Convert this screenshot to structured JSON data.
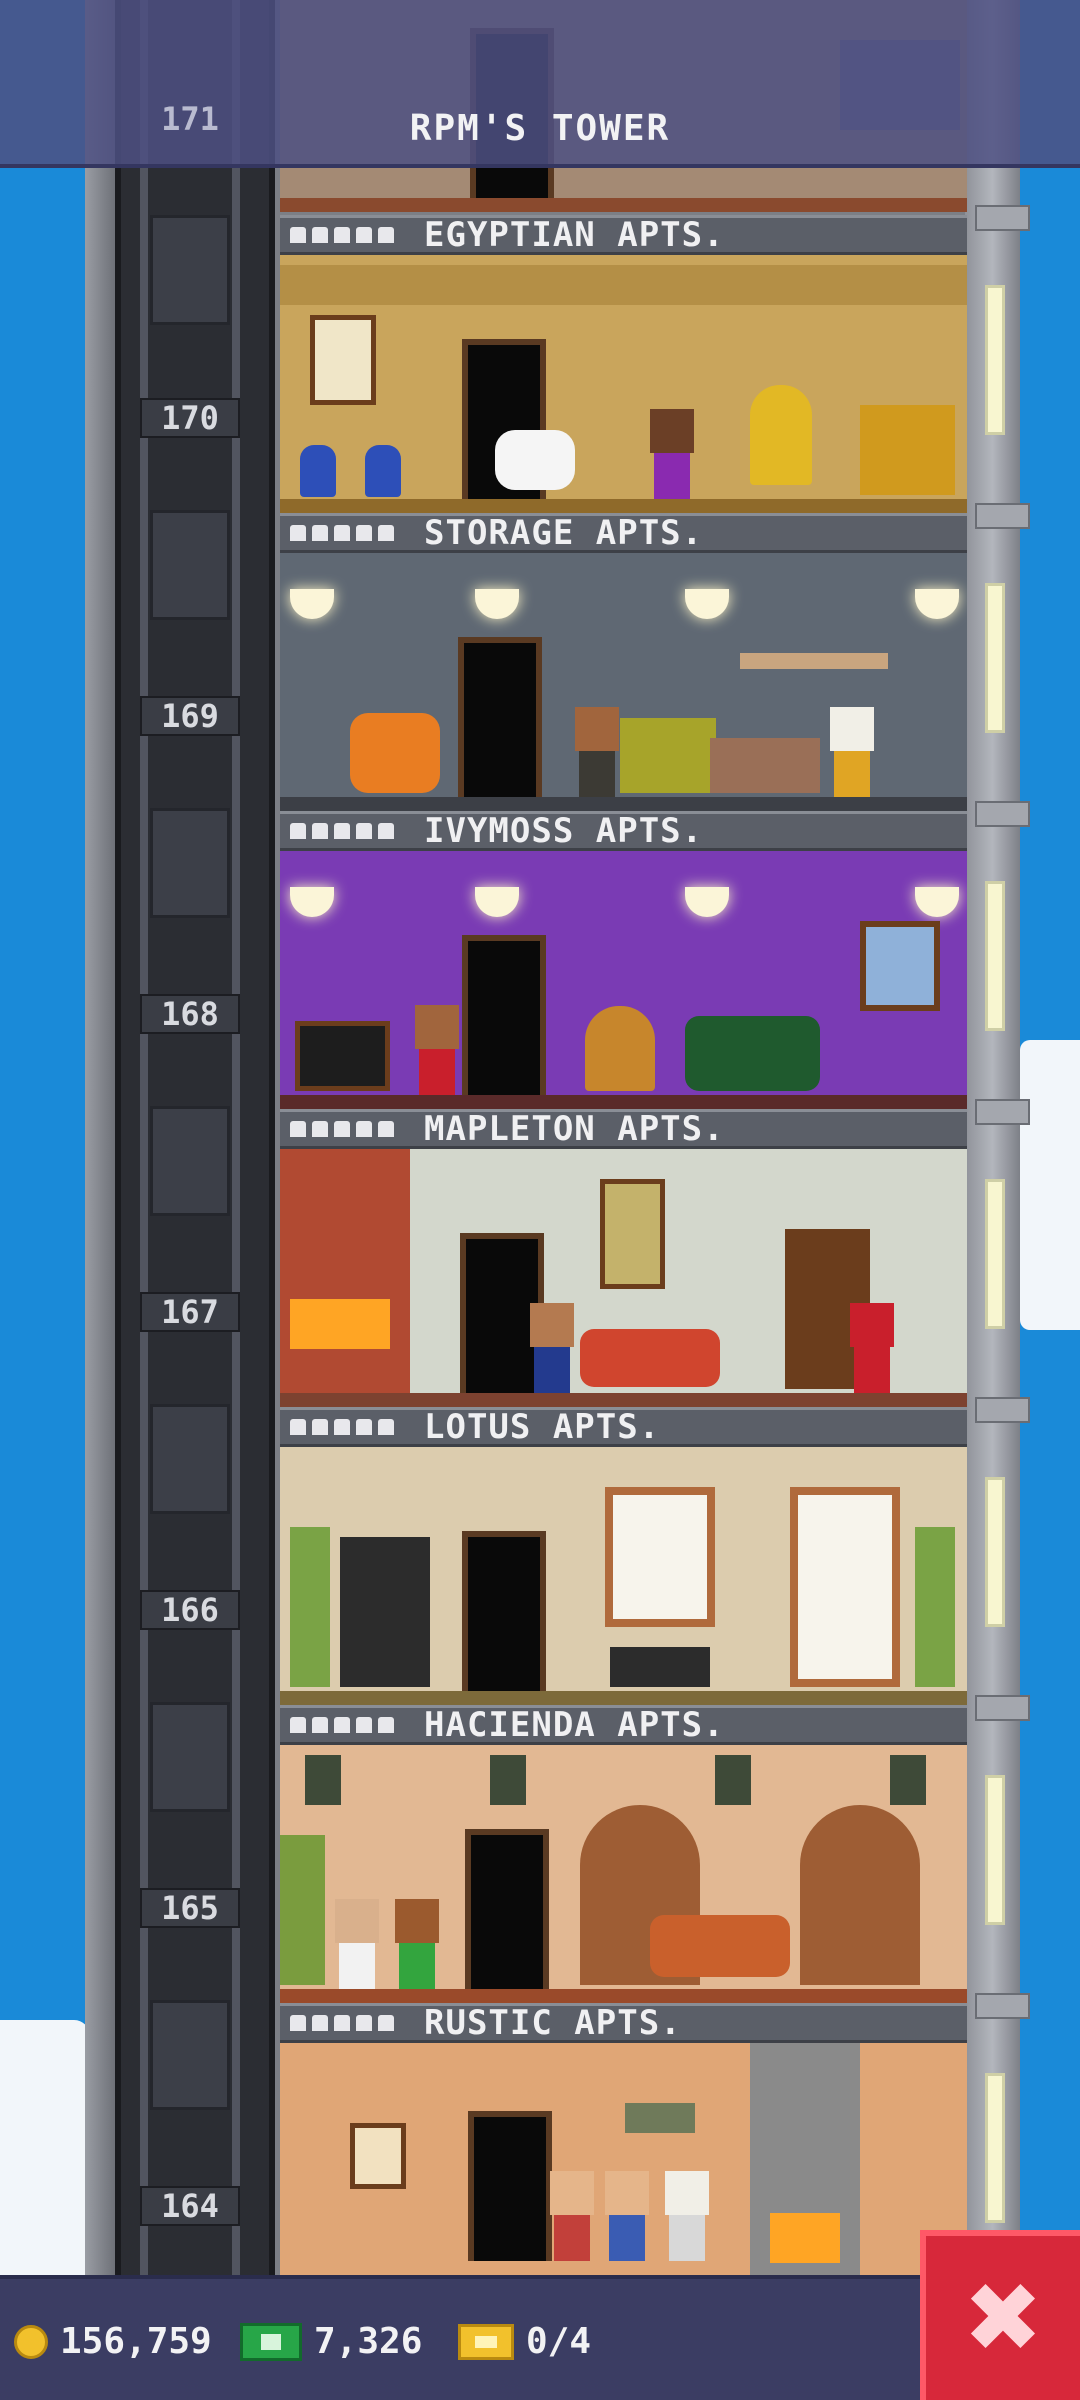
{
  "header": {
    "title": "RPM'S TOWER",
    "top_floor_number": "171"
  },
  "floors": [
    {
      "number": "170",
      "name": "EGYPTIAN APTS."
    },
    {
      "number": "169",
      "name": "STORAGE APTS."
    },
    {
      "number": "168",
      "name": "IVYMOSS APTS."
    },
    {
      "number": "167",
      "name": "MAPLETON APTS."
    },
    {
      "number": "166",
      "name": "LOTUS APTS."
    },
    {
      "number": "165",
      "name": "HACIENDA APTS."
    },
    {
      "number": "164",
      "name": "RUSTIC APTS."
    }
  ],
  "status": {
    "coins": "156,759",
    "bux": "7,326",
    "tickets": "0/4"
  },
  "icons": {
    "coin": "coin-icon",
    "bux": "bux-icon",
    "ticket": "ticket-icon",
    "close": "close-icon"
  },
  "close_label": "✖",
  "colors": {
    "sky": "#1a8ad8",
    "header": "#4e5082",
    "status_bar": "#3b3d63",
    "close_button": "#d7283a"
  }
}
